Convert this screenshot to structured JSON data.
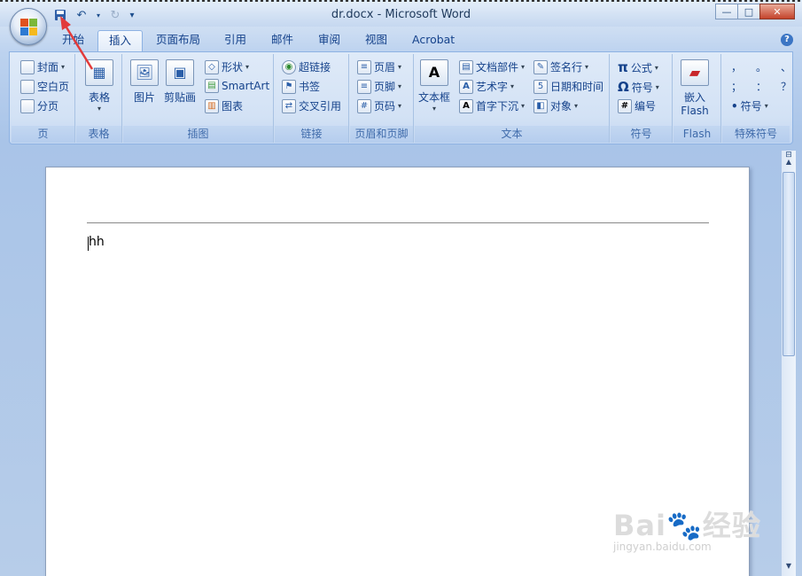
{
  "window": {
    "title": "dr.docx - Microsoft Word",
    "controls": {
      "minimize": "—",
      "maximize": "□",
      "close": "✕"
    }
  },
  "quick_access": {
    "save_icon": "save-icon",
    "undo_icon": "undo-icon",
    "redo_icon": "redo-icon",
    "customize": "▾"
  },
  "tabs": [
    {
      "label": "开始"
    },
    {
      "label": "插入"
    },
    {
      "label": "页面布局"
    },
    {
      "label": "引用"
    },
    {
      "label": "邮件"
    },
    {
      "label": "审阅"
    },
    {
      "label": "视图"
    },
    {
      "label": "Acrobat"
    }
  ],
  "active_tab": "插入",
  "help": "?",
  "ribbon": {
    "pages": {
      "label": "页",
      "items": [
        "封面",
        "空白页",
        "分页"
      ]
    },
    "tables": {
      "label": "表格",
      "button": "表格"
    },
    "illustrations": {
      "label": "插图",
      "picture": "图片",
      "clipart": "剪贴画",
      "shapes": "形状",
      "smartart": "SmartArt",
      "chart": "图表"
    },
    "links": {
      "label": "链接",
      "items": [
        "超链接",
        "书签",
        "交叉引用"
      ]
    },
    "header_footer": {
      "label": "页眉和页脚",
      "items": [
        "页眉",
        "页脚",
        "页码"
      ]
    },
    "text": {
      "label": "文本",
      "textbox": "文本框",
      "items1": [
        "文档部件",
        "艺术字",
        "首字下沉"
      ],
      "items2": [
        "签名行",
        "日期和时间",
        "对象"
      ]
    },
    "symbols": {
      "label": "符号",
      "items": [
        "公式",
        "符号",
        "编号"
      ]
    },
    "flash": {
      "label": "Flash",
      "button_line1": "嵌入",
      "button_line2": "Flash"
    },
    "special": {
      "label": "特殊符号",
      "chars": [
        "，",
        "。",
        "、",
        "；",
        "：",
        "？"
      ],
      "symbol": "符号"
    }
  },
  "document": {
    "text": "hh"
  },
  "watermark": {
    "brand": "Bai🐾经验",
    "url": "jingyan.baidu.com"
  }
}
